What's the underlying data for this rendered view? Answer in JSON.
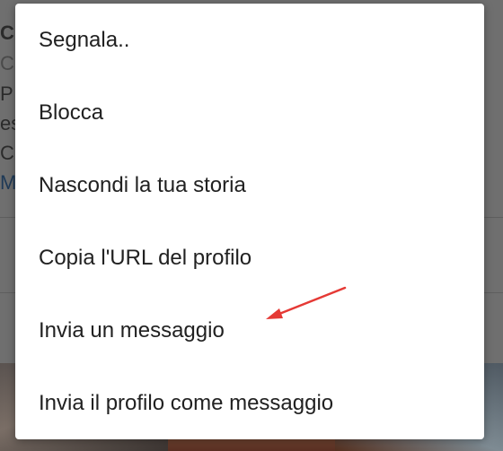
{
  "background": {
    "lines": [
      {
        "text": "C",
        "style": "bold"
      },
      {
        "text": "C",
        "style": "gray"
      },
      {
        "text": "P",
        "style": "normal"
      },
      {
        "text": "es",
        "style": "normal"
      },
      {
        "text": "C",
        "style": "normal"
      },
      {
        "text": "M",
        "style": "link"
      }
    ]
  },
  "menu": {
    "items": [
      {
        "label": "Segnala.."
      },
      {
        "label": "Blocca"
      },
      {
        "label": "Nascondi la tua storia"
      },
      {
        "label": "Copia l'URL del profilo"
      },
      {
        "label": "Invia un messaggio"
      },
      {
        "label": "Invia il profilo come messaggio"
      }
    ]
  },
  "annotation": {
    "arrow_color": "#e53935",
    "arrow_target": "Invia un messaggio"
  }
}
